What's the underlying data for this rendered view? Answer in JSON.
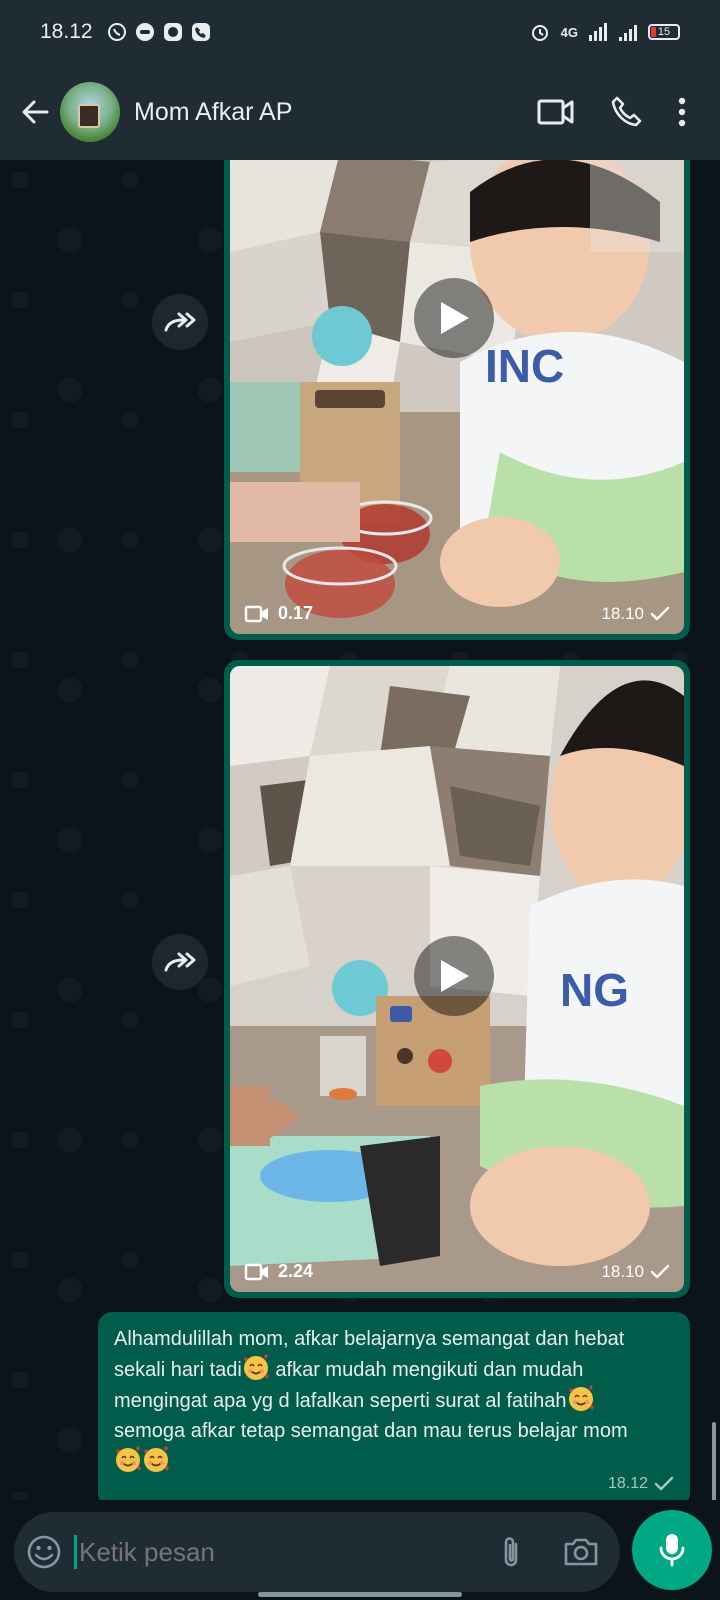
{
  "status_bar": {
    "time": "18.12",
    "network_label": "4G",
    "battery_level": "15",
    "icons": [
      "whatsapp-icon",
      "chat-icon",
      "messenger-icon",
      "phone-app-icon",
      "alarm-icon",
      "signal-icon",
      "battery-icon"
    ]
  },
  "header": {
    "contact_name": "Mom Afkar AP",
    "icons": [
      "back-arrow-icon",
      "avatar",
      "video-call-icon",
      "voice-call-icon",
      "more-options-icon"
    ]
  },
  "messages": [
    {
      "type": "video",
      "duration": "0.17",
      "time": "18.10",
      "status": "sent"
    },
    {
      "type": "video",
      "duration": "2.24",
      "time": "18.10",
      "status": "sent"
    },
    {
      "type": "text",
      "lines": [
        "Alhamdulillah mom, afkar belajarnya semangat dan hebat",
        "sekali hari tadi",
        " afkar mudah mengikuti dan mudah",
        "mengingat apa yg d lafalkan seperti surat al fatihah",
        "semoga afkar tetap semangat dan mau terus belajar mom"
      ],
      "time": "18.12",
      "status": "sent"
    }
  ],
  "composer": {
    "placeholder": "Ketik pesan",
    "icons": [
      "emoji-icon",
      "attach-icon",
      "camera-icon",
      "mic-icon"
    ]
  },
  "colors": {
    "header_bg": "#1f2c34",
    "chat_bg": "#0b141a",
    "outgoing_bubble": "#005c4b",
    "accent": "#00a884",
    "battery_low": "#e53935"
  }
}
